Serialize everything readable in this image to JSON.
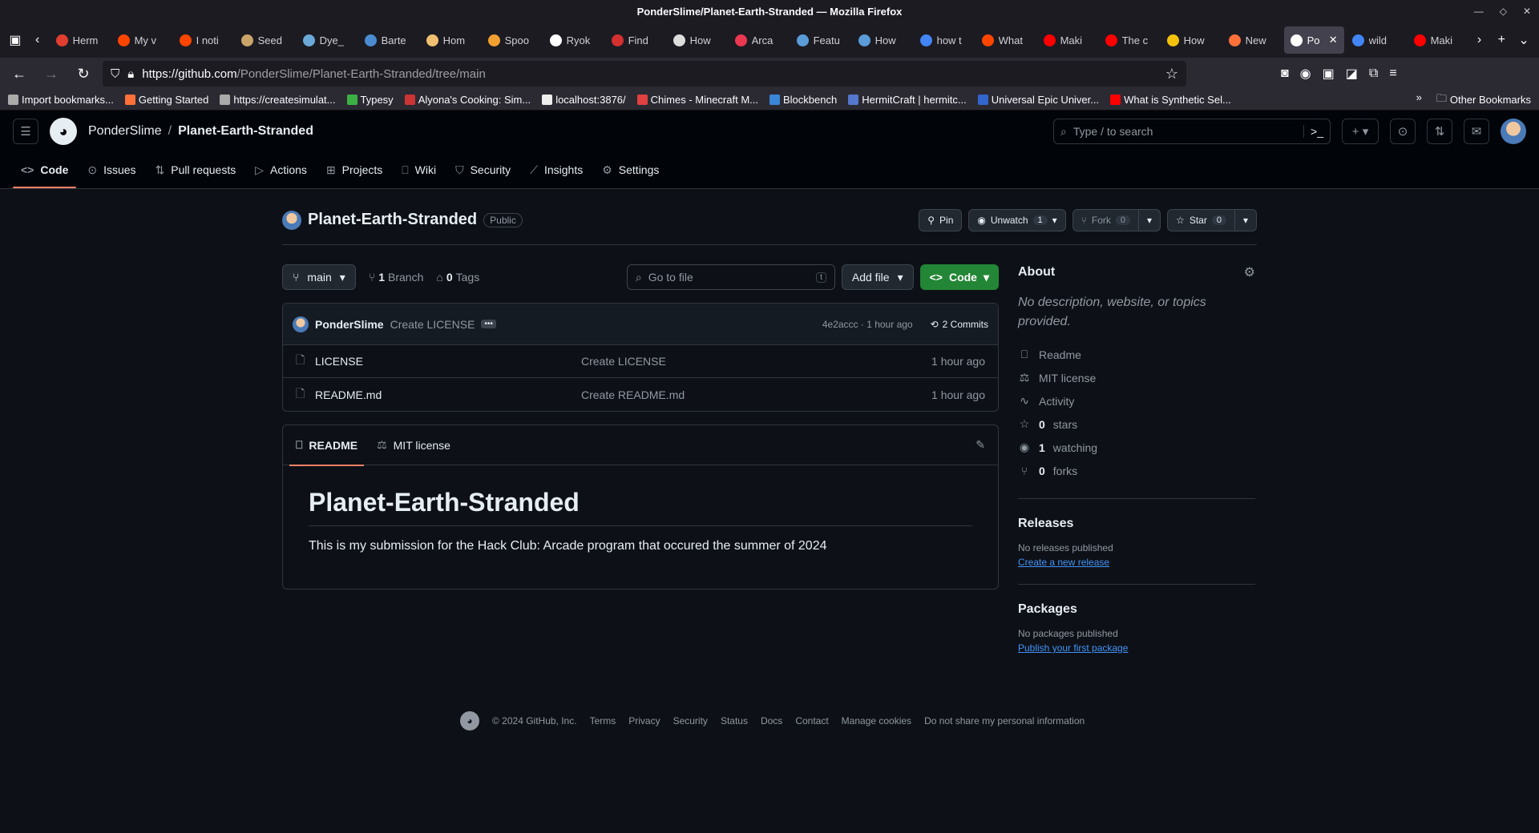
{
  "window": {
    "title": "PonderSlime/Planet-Earth-Stranded — Mozilla Firefox"
  },
  "tabs": [
    {
      "label": "Herm",
      "color": "#e03e2f"
    },
    {
      "label": "My v",
      "color": "#ff4500"
    },
    {
      "label": "I noti",
      "color": "#ff4500"
    },
    {
      "label": "Seed",
      "color": "#c9a56a"
    },
    {
      "label": "Dye_",
      "color": "#6aa9d8"
    },
    {
      "label": "Barte",
      "color": "#4a8ccf"
    },
    {
      "label": "Hom",
      "color": "#f0c070"
    },
    {
      "label": "Spoo",
      "color": "#f0a030"
    },
    {
      "label": "Ryok",
      "color": "#ffffff"
    },
    {
      "label": "Find",
      "color": "#d43030"
    },
    {
      "label": "How",
      "color": "#dddddd"
    },
    {
      "label": "Arca",
      "color": "#ec3750"
    },
    {
      "label": "Featu",
      "color": "#5a9cd8"
    },
    {
      "label": "How",
      "color": "#5a9cd8"
    },
    {
      "label": "how t",
      "color": "#4285f4"
    },
    {
      "label": "What",
      "color": "#ff4500"
    },
    {
      "label": "Maki",
      "color": "#ff0000"
    },
    {
      "label": "The c",
      "color": "#ff0000"
    },
    {
      "label": "How",
      "color": "#f4c20d"
    },
    {
      "label": "New",
      "color": "#ff7139"
    },
    {
      "label": "Po",
      "color": "#ffffff",
      "active": true
    },
    {
      "label": "wild",
      "color": "#4285f4"
    },
    {
      "label": "Maki",
      "color": "#ff0000"
    }
  ],
  "url": {
    "host": "https://github.com",
    "path": "/PonderSlime/Planet-Earth-Stranded/tree/main"
  },
  "bookmarks": [
    {
      "label": "Import bookmarks...",
      "color": "#aaaaaa"
    },
    {
      "label": "Getting Started",
      "color": "#ff7139"
    },
    {
      "label": "https://createsimulat...",
      "color": "#aaaaaa"
    },
    {
      "label": "Typesy",
      "color": "#3cb043"
    },
    {
      "label": "Alyona's Cooking: Sim...",
      "color": "#cc3333"
    },
    {
      "label": "localhost:3876/",
      "color": "#eeeeee"
    },
    {
      "label": "Chimes - Minecraft M...",
      "color": "#e04040"
    },
    {
      "label": "Blockbench",
      "color": "#3a86d8"
    },
    {
      "label": "HermitCraft | hermitc...",
      "color": "#5577cc"
    },
    {
      "label": "Universal Epic Univer...",
      "color": "#3366cc"
    },
    {
      "label": "What is Synthetic Sel...",
      "color": "#ff0000"
    }
  ],
  "other_bookmarks": "Other Bookmarks",
  "gh": {
    "owner": "PonderSlime",
    "repo": "Planet-Earth-Stranded",
    "search_placeholder": "Type / to search",
    "nav": [
      "Code",
      "Issues",
      "Pull requests",
      "Actions",
      "Projects",
      "Wiki",
      "Security",
      "Insights",
      "Settings"
    ],
    "visibility": "Public",
    "pin": "Pin",
    "unwatch": "Unwatch",
    "watch_count": "1",
    "fork": "Fork",
    "fork_count": "0",
    "star": "Star",
    "star_count": "0",
    "branch": "main",
    "branches_count": "1",
    "branches_label": "Branch",
    "tags_count": "0",
    "tags_label": "Tags",
    "go_to_file": "Go to file",
    "kbd": "t",
    "add_file": "Add file",
    "code_btn": "Code",
    "commit": {
      "author": "PonderSlime",
      "message": "Create LICENSE",
      "hash": "4e2accc · 1 hour ago",
      "commits": "2 Commits"
    },
    "files": [
      {
        "name": "LICENSE",
        "msg": "Create LICENSE",
        "time": "1 hour ago"
      },
      {
        "name": "README.md",
        "msg": "Create README.md",
        "time": "1 hour ago"
      }
    ],
    "readme_tab": "README",
    "license_tab": "MIT license",
    "readme_title": "Planet-Earth-Stranded",
    "readme_text": "This is my submission for the Hack Club: Arcade program that occured the summer of 2024",
    "about": {
      "heading": "About",
      "desc": "No description, website, or topics provided.",
      "readme": "Readme",
      "license": "MIT license",
      "activity": "Activity",
      "stars_n": "0",
      "stars": "stars",
      "watching_n": "1",
      "watching": "watching",
      "forks_n": "0",
      "forks": "forks"
    },
    "releases": {
      "heading": "Releases",
      "note": "No releases published",
      "link": "Create a new release"
    },
    "packages": {
      "heading": "Packages",
      "note": "No packages published",
      "link": "Publish your first package"
    },
    "footer": [
      "© 2024 GitHub, Inc.",
      "Terms",
      "Privacy",
      "Security",
      "Status",
      "Docs",
      "Contact",
      "Manage cookies",
      "Do not share my personal information"
    ]
  }
}
